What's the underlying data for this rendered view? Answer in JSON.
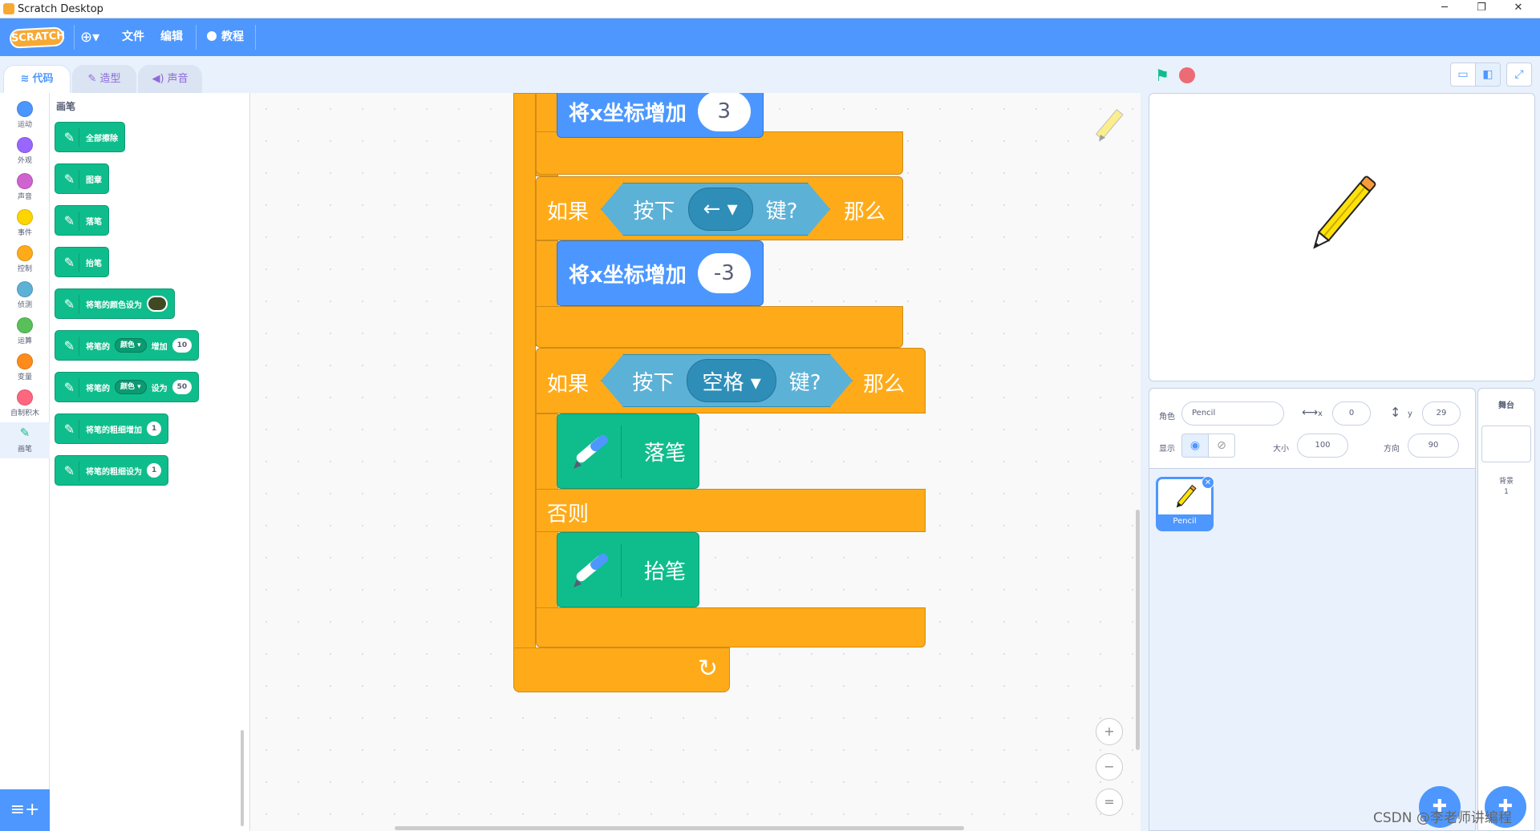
{
  "window": {
    "title": "Scratch Desktop",
    "min": "─",
    "restore": "❐",
    "close": "✕"
  },
  "menu": {
    "logo": "SCRATCH",
    "language": "⊕▾",
    "file": "文件",
    "edit": "编辑",
    "tutorials": "教程",
    "tutorials_icon": "lightbulb-icon"
  },
  "tabs": {
    "code": "代码",
    "costumes": "造型",
    "sounds": "声音"
  },
  "categories": [
    {
      "label": "运动",
      "color": "#4c97ff"
    },
    {
      "label": "外观",
      "color": "#9966ff"
    },
    {
      "label": "声音",
      "color": "#cf63cf"
    },
    {
      "label": "事件",
      "color": "#ffd500"
    },
    {
      "label": "控制",
      "color": "#ffab19"
    },
    {
      "label": "侦测",
      "color": "#5cb1d6"
    },
    {
      "label": "运算",
      "color": "#59c059"
    },
    {
      "label": "变量",
      "color": "#ff8c1a"
    },
    {
      "label": "自制积木",
      "color": "#ff6680"
    },
    {
      "label": "画笔",
      "color": "#0fbd8c"
    }
  ],
  "palette": {
    "title": "画笔",
    "blocks": {
      "clear": "全部擦除",
      "stamp": "图章",
      "pen_down": "落笔",
      "pen_up": "抬笔",
      "set_color": "将笔的颜色设为",
      "change_param_prefix": "将笔的",
      "param": "颜色 ▾",
      "change_by": "增加",
      "change_value": "10",
      "set_param_prefix": "将笔的",
      "set_to": "设为",
      "set_value": "50",
      "change_size": "将笔的粗细增加",
      "change_size_value": "1",
      "set_size": "将笔的粗细设为",
      "set_size_value": "1"
    }
  },
  "script": {
    "move_x_1": "将x坐标增加",
    "move_x_1_value": "3",
    "if_1": "如果",
    "key_pressed_1_a": "按下",
    "key_1": "← ▾",
    "key_pressed_1_b": "键?",
    "then_1": "那么",
    "move_x_2": "将x坐标增加",
    "move_x_2_value": "-3",
    "if_2": "如果",
    "key_pressed_2_a": "按下",
    "key_2": "空格 ▾",
    "key_pressed_2_b": "键?",
    "then_2": "那么",
    "pen_down": "落笔",
    "else": "否则",
    "pen_up": "抬笔",
    "loop_arrow": "↻"
  },
  "zoom": {
    "in": "+",
    "out": "−",
    "reset": "="
  },
  "sprite": {
    "label_sprite": "角色",
    "name": "Pencil",
    "x_label": "x",
    "x": "0",
    "y_label": "y",
    "y": "29",
    "show_label": "显示",
    "size_label": "大小",
    "size": "100",
    "direction_label": "方向",
    "direction": "90",
    "thumb_name": "Pencil"
  },
  "stage_panel": {
    "title": "舞台",
    "backdrops_label": "背景",
    "backdrops_count": "1"
  },
  "watermark": "CSDN @李老师讲编程"
}
